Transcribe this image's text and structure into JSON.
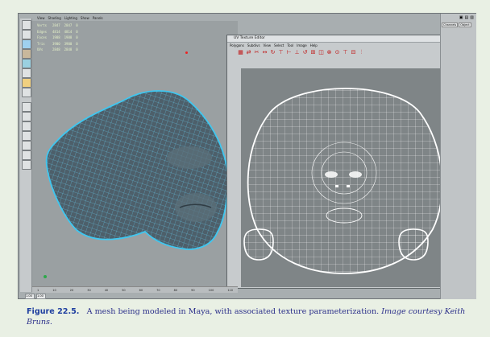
{
  "viewport": {
    "menu": [
      "View",
      "Shading",
      "Lighting",
      "Show",
      "Panels"
    ],
    "hud": [
      {
        "label": "Verts",
        "a": "2847",
        "b": "2847",
        "c": "0"
      },
      {
        "label": "Edges",
        "a": "4814",
        "b": "4814",
        "c": "0"
      },
      {
        "label": "Faces",
        "a": "1988",
        "b": "1988",
        "c": "0"
      },
      {
        "label": "Tris",
        "a": "3900",
        "b": "3900",
        "c": "0"
      },
      {
        "label": "UVs",
        "a": "2848",
        "b": "2848",
        "c": "0"
      }
    ]
  },
  "uv_editor": {
    "title": "UV Texture Editor",
    "menu": [
      "Polygons",
      "Subdivs",
      "View",
      "Select",
      "Tool",
      "Image",
      "Help"
    ]
  },
  "channel_box": {
    "tabs": [
      "Channels",
      "Object"
    ]
  },
  "timeline": {
    "ticks": [
      "1",
      "10",
      "20",
      "30",
      "40",
      "50",
      "60",
      "70",
      "80",
      "90",
      "100",
      "110"
    ],
    "start": "1.00",
    "end": "1.00"
  },
  "caption": {
    "figure": "Figure 22.5.",
    "text": "A mesh being modeled in Maya, with associated texture parameterization.",
    "credit": "Image courtesy Keith Bruns."
  },
  "colors": {
    "mesh_edge": "#3fc7f0",
    "mesh_fill": "#4d5f6a",
    "uv_lines": "#ffffff",
    "caption": "#2b2f8a"
  }
}
